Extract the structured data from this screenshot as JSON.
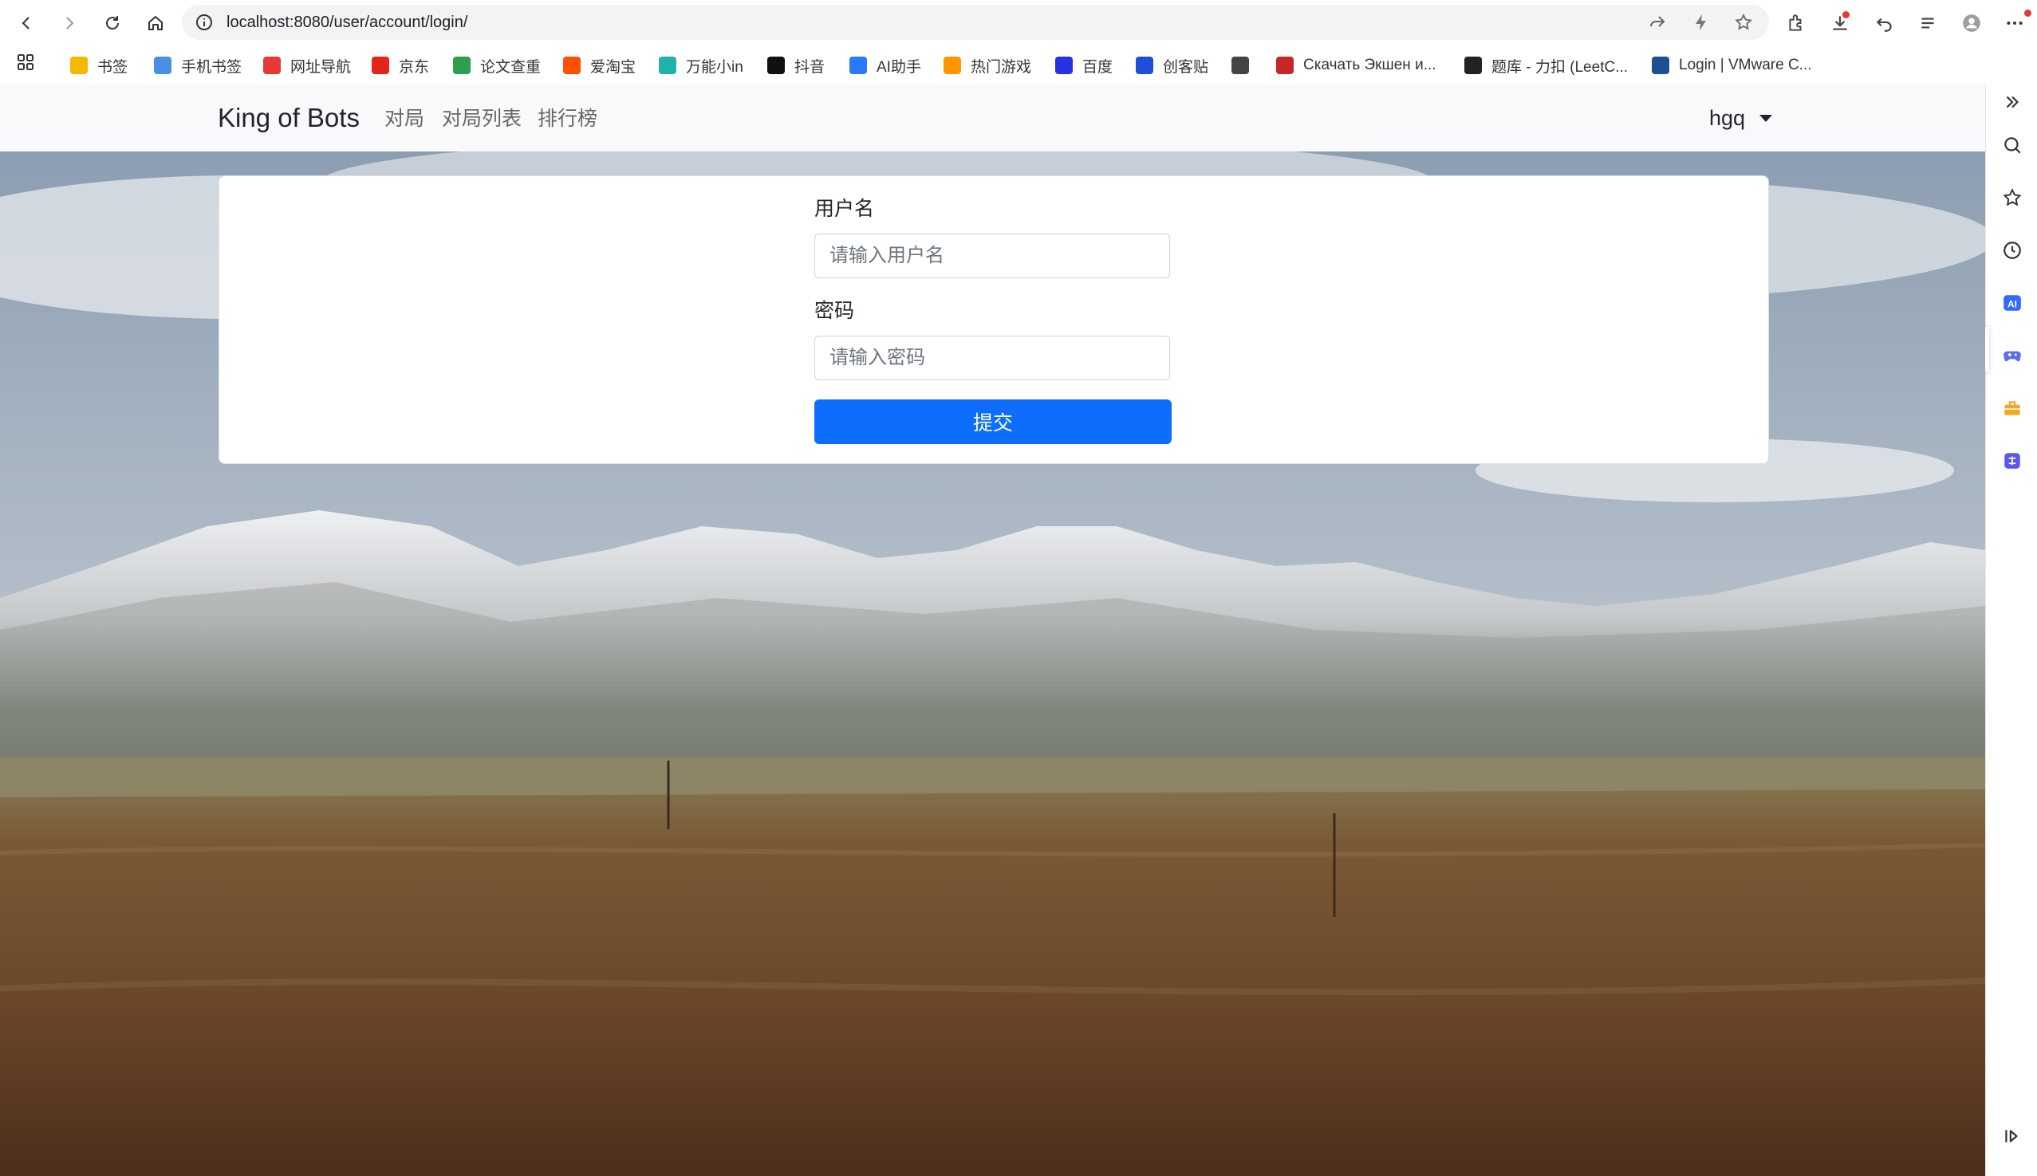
{
  "browser": {
    "url": "localhost:8080/user/account/login/",
    "bookmarks": [
      {
        "label": "书签",
        "color": "#f5b800"
      },
      {
        "label": "手机书签",
        "color": "#4a90e2"
      },
      {
        "label": "网址导航",
        "color": "#e53935"
      },
      {
        "label": "京东",
        "color": "#e1251b"
      },
      {
        "label": "论文查重",
        "color": "#2e9e4f"
      },
      {
        "label": "爱淘宝",
        "color": "#ff5000"
      },
      {
        "label": "万能小in",
        "color": "#20b2aa"
      },
      {
        "label": "抖音",
        "color": "#111111"
      },
      {
        "label": "AI助手",
        "color": "#2979ff"
      },
      {
        "label": "热门游戏",
        "color": "#ff9800"
      },
      {
        "label": "百度",
        "color": "#2932e1"
      },
      {
        "label": "创客贴",
        "color": "#1e4fd8"
      },
      {
        "label": "",
        "color": "#444444"
      },
      {
        "label": "Скачать Экшен и...",
        "color": "#c62828"
      },
      {
        "label": "题库 - 力扣 (LeetC...",
        "color": "#222222"
      },
      {
        "label": "Login | VMware C...",
        "color": "#1d4f91"
      }
    ]
  },
  "navbar": {
    "brand": "King of Bots",
    "links": [
      "对局",
      "对局列表",
      "排行榜"
    ],
    "user": "hgq"
  },
  "login_form": {
    "username_label": "用户名",
    "username_placeholder": "请输入用户名",
    "username_value": "",
    "password_label": "密码",
    "password_placeholder": "请输入密码",
    "password_value": "",
    "submit_label": "提交"
  },
  "sidebar": {
    "translate_glyph": "译"
  }
}
